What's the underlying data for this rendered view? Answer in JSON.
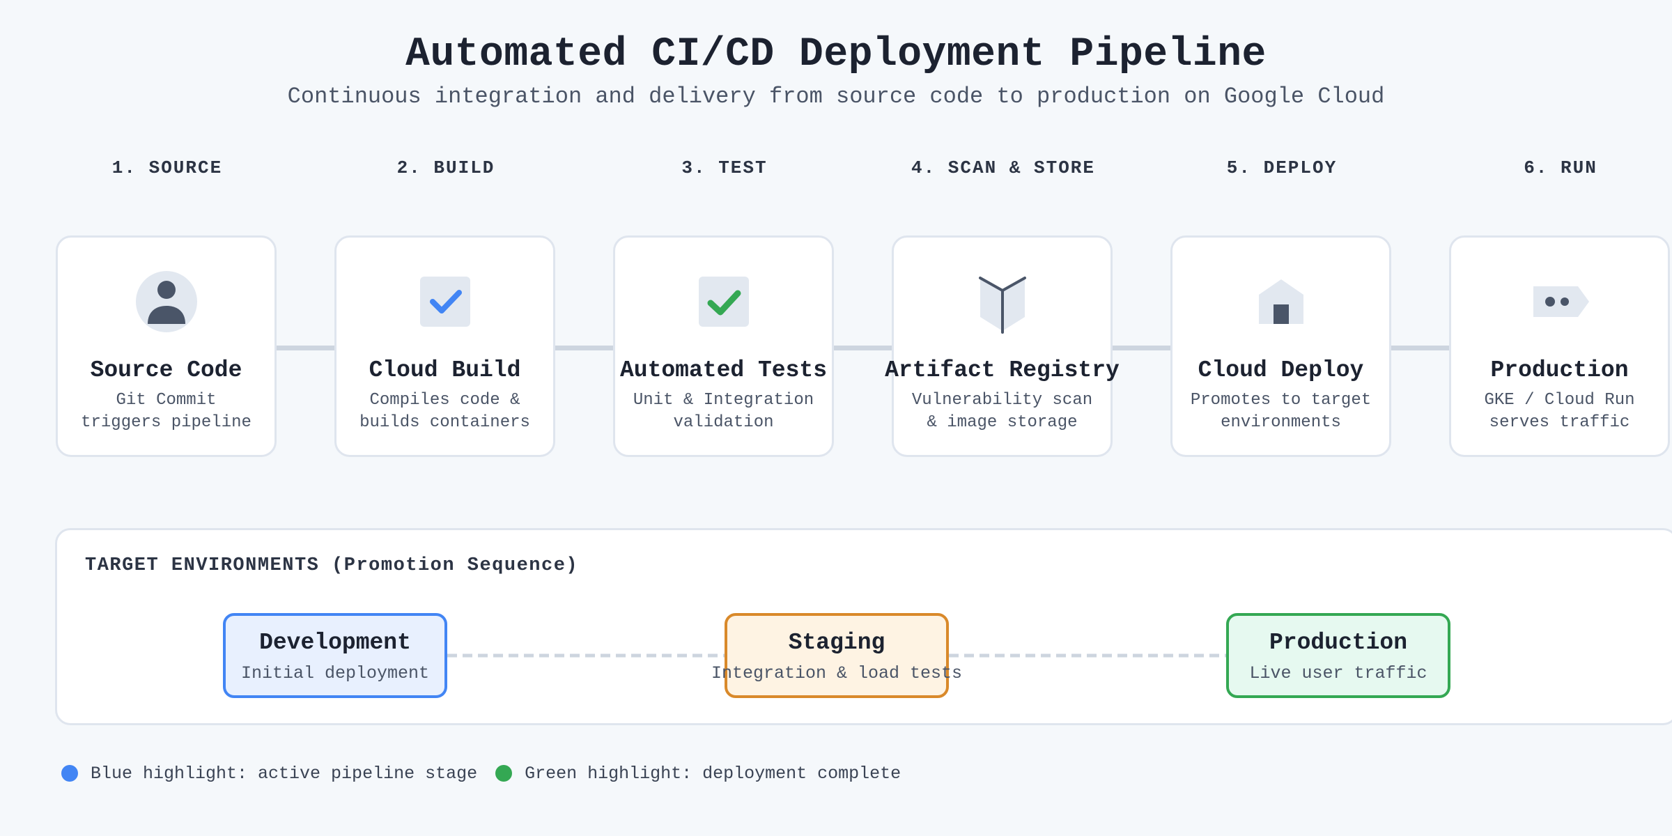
{
  "header": {
    "title": "Automated CI/CD Deployment Pipeline",
    "subtitle": "Continuous integration and delivery from source code to production on Google Cloud"
  },
  "stages": [
    {
      "label": "1. SOURCE",
      "name": "Source Code",
      "desc_line1": "Git Commit",
      "desc_line2": "triggers pipeline",
      "icon": "user-icon"
    },
    {
      "label": "2. BUILD",
      "name": "Cloud Build",
      "desc_line1": "Compiles code &",
      "desc_line2": "builds containers",
      "icon": "checkbox-icon"
    },
    {
      "label": "3. TEST",
      "name": "Automated Tests",
      "desc_line1": "Unit & Integration",
      "desc_line2": "validation",
      "icon": "check-icon"
    },
    {
      "label": "4. SCAN & STORE",
      "name": "Artifact Registry",
      "desc_line1": "Vulnerability scan",
      "desc_line2": "& image storage",
      "icon": "package-icon"
    },
    {
      "label": "5. DEPLOY",
      "name": "Cloud Deploy",
      "desc_line1": "Promotes to target",
      "desc_line2": "environments",
      "icon": "house-icon"
    },
    {
      "label": "6. RUN",
      "name": "Production",
      "desc_line1": "GKE / Cloud Run",
      "desc_line2": "serves traffic",
      "icon": "tag-icon"
    }
  ],
  "environments": {
    "heading": "TARGET ENVIRONMENTS (Promotion Sequence)",
    "items": [
      {
        "name": "Development",
        "desc": "Initial deployment",
        "border": "#4285f4",
        "fill": "#e8f0fe"
      },
      {
        "name": "Staging",
        "desc": "Integration & load tests",
        "border": "#d9892a",
        "fill": "#fef3e3"
      },
      {
        "name": "Production",
        "desc": "Live user traffic",
        "border": "#34a853",
        "fill": "#e6f9f0"
      }
    ]
  },
  "legend": [
    {
      "color": "#4285f4",
      "text": "Blue highlight: active pipeline stage"
    },
    {
      "color": "#34a853",
      "text": "Green highlight: deployment complete"
    }
  ],
  "colors": {
    "icon_bg": "#e2e8f0",
    "icon_dark": "#4a5568",
    "blue": "#4285f4",
    "green": "#34a853",
    "connector": "#cdd5df"
  }
}
